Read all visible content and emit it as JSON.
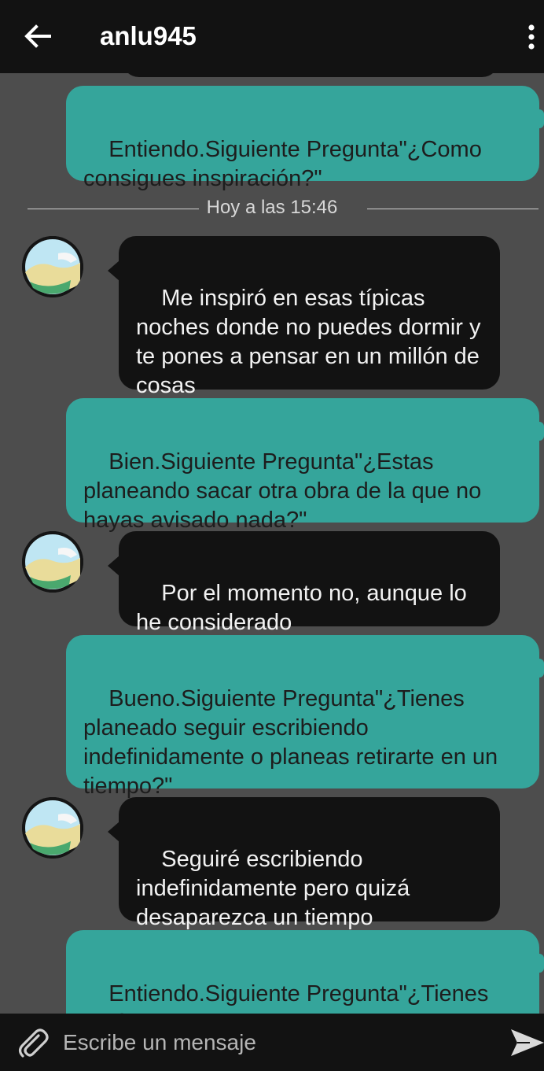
{
  "header": {
    "title": "anlu945",
    "back_icon": "arrow-left-icon",
    "menu_icon": "more-vertical-icon"
  },
  "chat": {
    "time_separator": "Hoy a las 15:46",
    "messages": [
      {
        "side": "out",
        "text": "Entiendo.Siguiente Pregunta\"¿Como consigues inspiración?\""
      },
      {
        "side": "in",
        "text": "Me inspiró en esas típicas noches donde no puedes dormir y te pones a pensar en un millón de cosas"
      },
      {
        "side": "out",
        "text": "Bien.Siguiente Pregunta\"¿Estas planeando sacar otra obra de la que no hayas avisado nada?\""
      },
      {
        "side": "in",
        "text": "Por el momento no, aunque lo he considerado"
      },
      {
        "side": "out",
        "text": "Bueno.Siguiente Pregunta\"¿Tienes planeado seguir escribiendo indefinidamente o planeas retirarte en un tiempo?\""
      },
      {
        "side": "in",
        "text": "Seguiré escribiendo indefinidamente pero quizá desaparezca un tiempo"
      },
      {
        "side": "out",
        "text": "Entiendo.Siguiente Pregunta\"¿Tienes algún Fic favorito?\""
      }
    ]
  },
  "composer": {
    "placeholder": "Escribe un mensaje",
    "attach_icon": "paperclip-icon",
    "send_icon": "send-icon"
  },
  "colors": {
    "outgoing_bubble": "#35a59b",
    "incoming_bubble": "#121212",
    "background": "#4d4d4d",
    "bars": "#121212"
  }
}
